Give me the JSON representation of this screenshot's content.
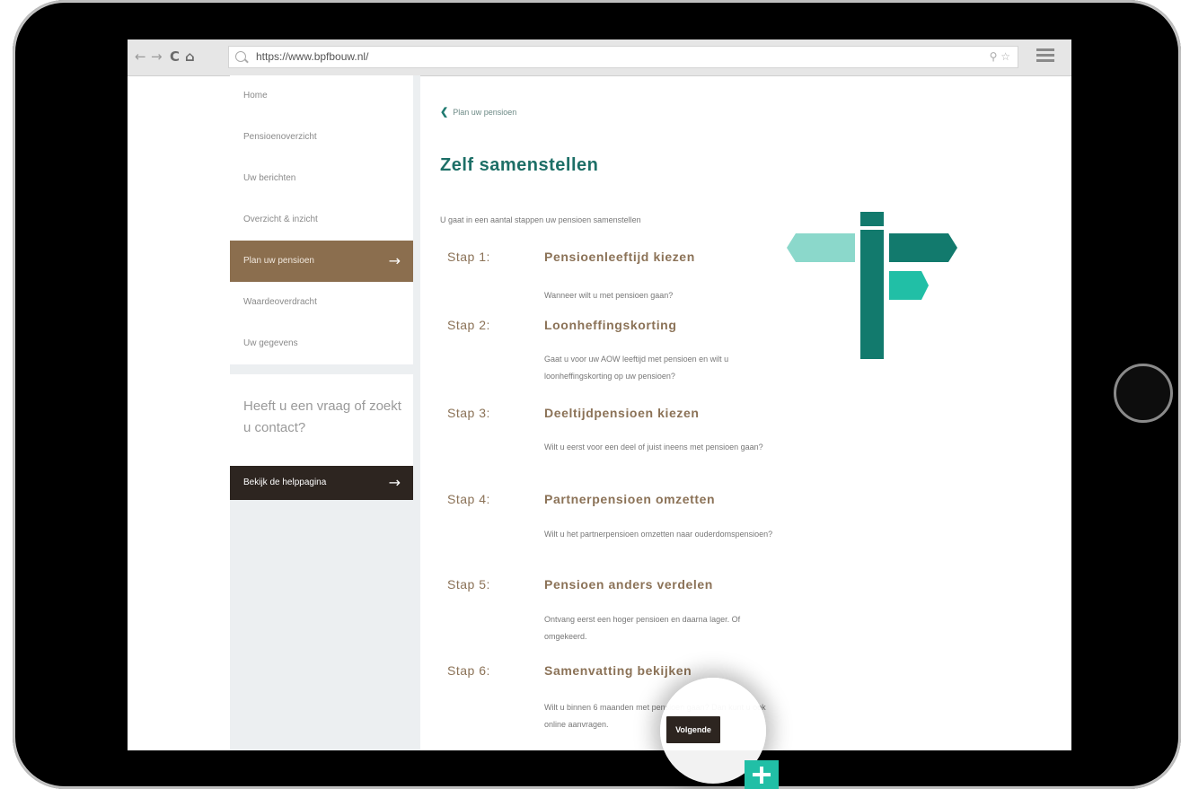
{
  "browser": {
    "back": "←",
    "forward": "→",
    "reload": "C",
    "home": "⌂",
    "url": "https://www.bpfbouw.nl/",
    "url_right": "⚲ ☆"
  },
  "sidebar": {
    "items": [
      {
        "label": "Home"
      },
      {
        "label": "Pensioenoverzicht"
      },
      {
        "label": "Uw berichten"
      },
      {
        "label": "Overzicht & inzicht"
      },
      {
        "label": "Plan uw pensioen",
        "active": true
      },
      {
        "label": "Waardeoverdracht"
      },
      {
        "label": "Uw gegevens"
      }
    ],
    "active_arrow": "→",
    "help_text": "Heeft u een vraag of zoekt u contact?",
    "help_button": "Bekijk de helppagina",
    "help_arrow": "→"
  },
  "main": {
    "back_link": "Plan uw pensioen",
    "back_chevron": "❮",
    "title": "Zelf samenstellen",
    "intro": "U gaat in een aantal stappen uw pensioen samenstellen",
    "steps": [
      {
        "label": "Stap 1:",
        "title": "Pensioenleeftijd kiezen",
        "desc": "Wanneer wilt u met pensioen gaan?"
      },
      {
        "label": "Stap 2:",
        "title": "Loonheffingskorting",
        "desc": "Gaat u voor uw AOW leeftijd met pensioen en wilt u loonheffingskorting op uw pensioen?"
      },
      {
        "label": "Stap 3:",
        "title": "Deeltijdpensioen kiezen",
        "desc": "Wilt u eerst voor een deel of juist ineens met pensioen gaan?"
      },
      {
        "label": "Stap 4:",
        "title": "Partnerpensioen omzetten",
        "desc": "Wilt u het partnerpensioen omzetten naar ouderdomspensioen?"
      },
      {
        "label": "Stap 5:",
        "title": "Pensioen anders verdelen",
        "desc": "Ontvang eerst een hoger pensioen en daarna lager. Of omgekeerd."
      },
      {
        "label": "Stap 6:",
        "title": "Samenvatting bekijken",
        "desc": "Wilt u binnen 6 maanden met pensioen gaan? Dan kunt u ook online aanvragen."
      }
    ],
    "next_button": "Volgende"
  },
  "colors": {
    "brand_teal": "#1d6f67",
    "accent_brown": "#8b6e4e",
    "dark_button": "#2d2520",
    "plus_green": "#21bfa6"
  }
}
